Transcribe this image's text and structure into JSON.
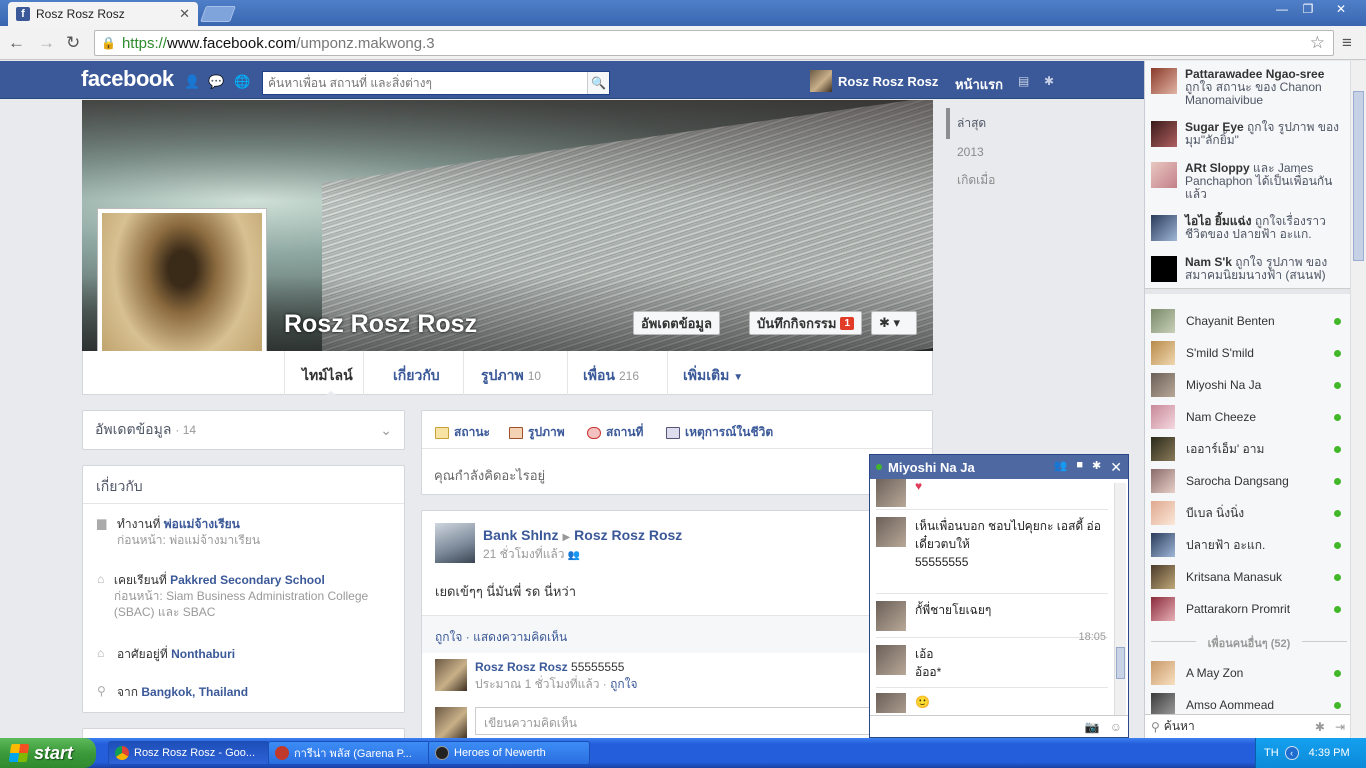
{
  "browser": {
    "tab_title": "Rosz Rosz Rosz",
    "tab_close": "✕",
    "url_scheme": "https://",
    "url_host": "www.facebook.com",
    "url_path": "/umponz.makwong.3",
    "win_min": "—",
    "win_max": "❐",
    "win_close": "✕"
  },
  "fb": {
    "logo": "facebook",
    "search_placeholder": "ค้นหาเพื่อน สถานที่ และสิ่งต่างๆ",
    "user_name": "Rosz Rosz Rosz",
    "home": "หน้าแรก"
  },
  "profile": {
    "name": "Rosz Rosz Rosz",
    "update_info_btn": "อัพเดตข้อมูล",
    "activity_log_btn": "บันทึกกิจกรรม",
    "activity_badge": "1",
    "tabs": [
      {
        "label": "ไทม์ไลน์",
        "count": ""
      },
      {
        "label": "เกี่ยวกับ",
        "count": ""
      },
      {
        "label": "รูปภาพ",
        "count": "10"
      },
      {
        "label": "เพื่อน",
        "count": "216"
      },
      {
        "label": "เพิ่มเติม",
        "count": ""
      }
    ]
  },
  "timeline_nav": [
    "ล่าสุด",
    "2013",
    "เกิดเมื่อ"
  ],
  "updates_box": {
    "label": "อัพเดตข้อมูล",
    "count": "· 14"
  },
  "about": {
    "header": "เกี่ยวกับ",
    "items": [
      {
        "prefix": "ทำงานที่ ",
        "link": "พ่อแม่จ้างเรียน",
        "sub": "ก่อนหน้า: พ่อแม่จ้างมาเรียน"
      },
      {
        "prefix": "เคยเรียนที่ ",
        "link": "Pakkred Secondary School",
        "sub": "ก่อนหน้า: Siam Business Administration College (SBAC) และ SBAC"
      },
      {
        "prefix": "อาศัยอยู่ที่ ",
        "link": "Nonthaburi",
        "sub": ""
      },
      {
        "prefix": "จาก ",
        "link": "Bangkok, Thailand",
        "sub": ""
      }
    ]
  },
  "composer": {
    "tabs": [
      "สถานะ",
      "รูปภาพ",
      "สถานที่",
      "เหตุการณ์ในชีวิต"
    ],
    "placeholder": "คุณกำลังคิดอะไรอยู่"
  },
  "post": {
    "author": "Bank ShInz",
    "target": "Rosz Rosz Rosz",
    "time": "21 ชั่วโมงที่แล้ว",
    "text": "เยดเข้ๆๆ นี่มันพี่ รด นี่หว่า",
    "actions": "ถูกใจ · แสดงความคิดเห็น",
    "comment_author": "Rosz Rosz Rosz",
    "comment_text": " 55555555",
    "comment_meta": "ประมาณ 1 ชั่วโมงที่แล้ว · ",
    "comment_like": "ถูกใจ",
    "write_placeholder": "เขียนความคิดเห็น"
  },
  "chat": {
    "name": "Miyoshi Na Ja",
    "time": "18:05",
    "messages": [
      {
        "lines": "♥"
      },
      {
        "lines": "เห็นเพื่อนบอก ชอบไปคุยกะ เอสดี้ อ่อ"
      },
      {
        "lines": "เดี๋ยวตบให้"
      },
      {
        "lines": "55555555"
      },
      {
        "lines": "กั้พี่ชายโยเฉยๆ"
      },
      {
        "lines": "เอ้อ"
      },
      {
        "lines": "อ้ออ*"
      },
      {
        "lines": "🙂"
      }
    ]
  },
  "ticker": [
    {
      "name": "Pattarawadee Ngao-sree",
      "rest": " ถูกใจ สถานะ ของ Chanon Manomaivibue"
    },
    {
      "name": "Sugar Eye",
      "rest": " ถูกใจ รูปภาพ ของ มุม\"ลักยิ้ม\""
    },
    {
      "name": "ARt Sloppy",
      "rest": " และ James Panchaphon ได้เป็นเพื่อนกันแล้ว"
    },
    {
      "name": "ไอไอ ยิ้มแฉ่ง",
      "rest": " ถูกใจเรื่องราวชีวิตของ ปลายฟ้า อะแก."
    },
    {
      "name": "Nam S'k",
      "rest": " ถูกใจ รูปภาพ ของ สมาคมนิยมนางฟ้า (สนนฟ)"
    }
  ],
  "friends_online": [
    "Chayanit Benten",
    "S'mild S'mild",
    "Miyoshi Na Ja",
    "Nam Cheeze",
    "เออาร์เอ็ม' อาม",
    "Sarocha Dangsang",
    "บีเบล นิ่งนิ่ง",
    "ปลายฟ้า อะแก.",
    "Kritsana Manasuk",
    "Pattarakorn Promrit"
  ],
  "more_friends_header": "เพื่อนคนอื่นๆ (52)",
  "more_friends": [
    "A May Zon",
    "Amso Aommead"
  ],
  "sidebar_search": "ค้นหา",
  "taskbar": {
    "start": "start",
    "items": [
      "Rosz Rosz Rosz - Goo...",
      "การีน่า พลัส (Garena P...",
      "Heroes of Newerth"
    ],
    "lang": "TH",
    "clock": "4:39 PM"
  },
  "colors": {
    "fb_blue": "#3b5998",
    "online_green": "#42b72a",
    "badge_red": "#e23c28"
  }
}
